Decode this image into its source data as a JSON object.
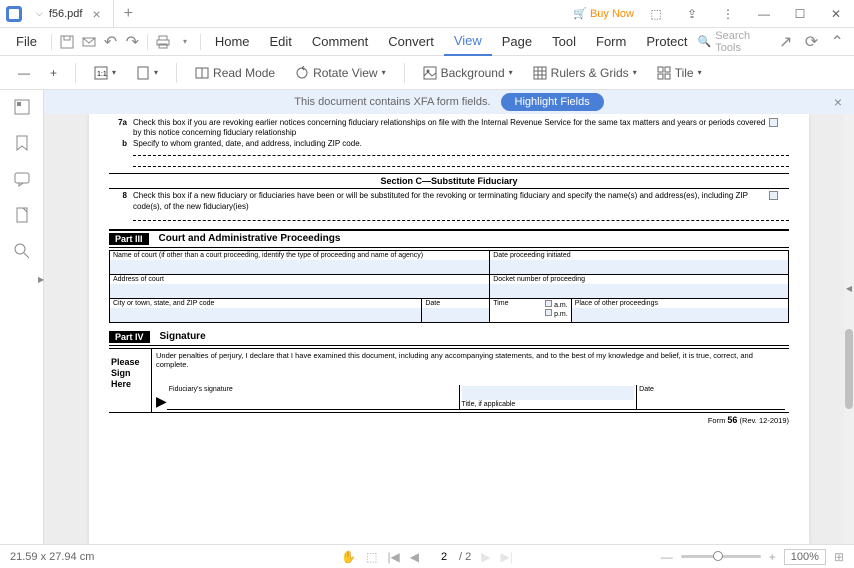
{
  "tab": {
    "title": "f56.pdf"
  },
  "titlebar": {
    "buy_now": "Buy Now"
  },
  "menu": {
    "file": "File",
    "items": [
      "Home",
      "Edit",
      "Comment",
      "Convert",
      "View",
      "Page",
      "Tool",
      "Form",
      "Protect"
    ],
    "active_index": 4,
    "search_placeholder": "Search Tools"
  },
  "toolbar": {
    "read_mode": "Read Mode",
    "rotate_view": "Rotate View",
    "background": "Background",
    "rulers_grids": "Rulers & Grids",
    "tile": "Tile"
  },
  "banner": {
    "text": "This document contains XFA form fields.",
    "button": "Highlight Fields"
  },
  "doc": {
    "row7a": {
      "num": "7a",
      "text": "Check this box if you are revoking earlier notices concerning fiduciary relationships on file with the Internal Revenue Service for the same tax matters and years or periods covered by this notice concerning fiduciary relationship"
    },
    "row7b": {
      "num": "b",
      "text": "Specify to whom granted, date, and address, including ZIP code."
    },
    "section_c": "Section C—Substitute Fiduciary",
    "row8": {
      "num": "8",
      "text": "Check this box if a new fiduciary or fiduciaries have been or will be substituted for the revoking or terminating fiduciary and specify the name(s) and address(es), including ZIP code(s), of the new fiduciary(ies)"
    },
    "part3": {
      "badge": "Part III",
      "title": "Court and Administrative Proceedings"
    },
    "table": {
      "name_court": "Name of court (if other than a court proceeding, identify the type of proceeding and name of agency)",
      "date_initiated": "Date proceeding initiated",
      "address": "Address of court",
      "docket": "Docket number of proceeding",
      "city": "City or town, state, and ZIP code",
      "date": "Date",
      "time": "Time",
      "am": "a.m.",
      "pm": "p.m.",
      "place": "Place of other proceedings"
    },
    "part4": {
      "badge": "Part IV",
      "title": "Signature"
    },
    "sig": {
      "please": "Please",
      "sign": "Sign",
      "here": "Here",
      "perjury": "Under penalties of perjury, I declare that I have examined this document, including any accompanying statements, and to the best of my knowledge and belief, it is true, correct, and complete.",
      "fiduciary": "Fiduciary's signature",
      "title_if": "Title, if applicable",
      "date": "Date"
    },
    "footer": {
      "form": "Form",
      "num": "56",
      "rev": "(Rev. 12-2019)"
    }
  },
  "status": {
    "dimensions": "21.59 x 27.94 cm",
    "page_current": "2",
    "page_total": "/ 2",
    "zoom": "100%"
  }
}
